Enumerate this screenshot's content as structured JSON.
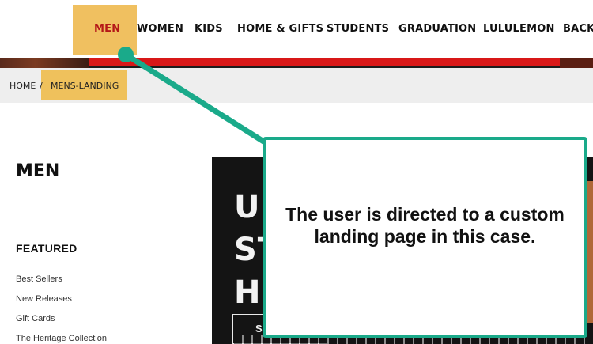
{
  "nav": {
    "items": [
      "MEN",
      "WOMEN",
      "KIDS",
      "HOME & GIFTS",
      "STUDENTS",
      "GRADUATION",
      "LULULEMON",
      "BACK"
    ],
    "active": "MEN"
  },
  "breadcrumb": {
    "home": "HOME",
    "separator": "/",
    "current": "MENS-LANDING"
  },
  "sidebar": {
    "title": "MEN",
    "featured_heading": "FEATURED",
    "links": [
      "Best Sellers",
      "New Releases",
      "Gift Cards",
      "The Heritage Collection"
    ]
  },
  "promo": {
    "lines": [
      "US",
      "ST",
      "HI"
    ],
    "button_label": "S"
  },
  "callout": {
    "text": "The user is directed to a custom landing page in this case."
  },
  "colors": {
    "highlight": "#f0c060",
    "callout_border": "#1aaa8a",
    "hero_red": "#d81818"
  }
}
